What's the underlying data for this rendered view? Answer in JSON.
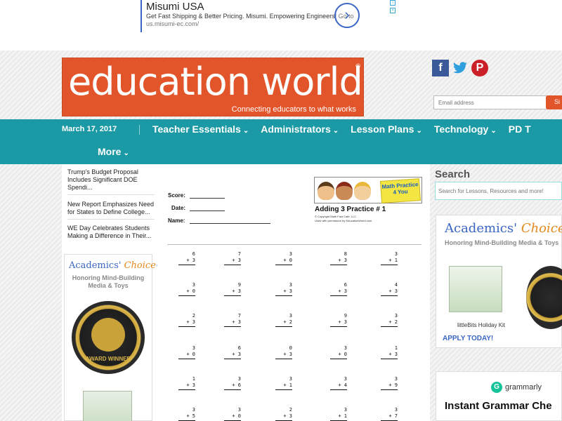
{
  "ad": {
    "title": "Misumi USA",
    "text": "Get Fast Shipping & Better Pricing. Misumi. Empowering Engineers!",
    "link": "Go to us.misumi-ec.com/"
  },
  "logo": {
    "word1": "education",
    "word2": "world",
    "reg": "®",
    "tagline": "Connecting educators to what works"
  },
  "email": {
    "placeholder": "Email address",
    "button": "Si"
  },
  "nav": {
    "date": "March 17, 2017",
    "items": [
      "Teacher Essentials",
      "Administrators",
      "Lesson Plans",
      "Technology",
      "PD T"
    ],
    "more": "More"
  },
  "news": [
    "Trump's Budget Proposal Includes Significant DOE Spendi...",
    "New Report Emphasizes Need for States to Define College...",
    "WE Day Celebrates Students Making a Difference in Their..."
  ],
  "academics_left": {
    "title_a": "Academics'",
    "title_b": "Choice",
    "tm": "™",
    "subtitle": "Honoring Mind-Building Media & Toys",
    "medal_text": "AWARD WINNER"
  },
  "worksheet": {
    "score": "Score:",
    "date": "Date:",
    "name": "Name:",
    "badge": "Math Practice 4 You",
    "title": "Adding 3  Practice # 1",
    "copyright": "© Copyright Math Fact Cafe, LLC",
    "used": "Used with permission by EducationWorld.com",
    "rows": [
      [
        [
          "6",
          "3"
        ],
        [
          "7",
          "3"
        ],
        [
          "3",
          "0"
        ],
        [
          "8",
          "3"
        ],
        [
          "3",
          "1"
        ]
      ],
      [
        [
          "3",
          "0"
        ],
        [
          "9",
          "3"
        ],
        [
          "3",
          "3"
        ],
        [
          "6",
          "3"
        ],
        [
          "4",
          "3"
        ]
      ],
      [
        [
          "2",
          "3"
        ],
        [
          "7",
          "3"
        ],
        [
          "3",
          "2"
        ],
        [
          "9",
          "3"
        ],
        [
          "3",
          "2"
        ]
      ],
      [
        [
          "3",
          "0"
        ],
        [
          "6",
          "3"
        ],
        [
          "0",
          "3"
        ],
        [
          "3",
          "0"
        ],
        [
          "1",
          "3"
        ]
      ],
      [
        [
          "1",
          "3"
        ],
        [
          "3",
          "6"
        ],
        [
          "3",
          "1"
        ],
        [
          "3",
          "4"
        ],
        [
          "3",
          "9"
        ]
      ],
      [
        [
          "3",
          "5"
        ],
        [
          "3",
          "0"
        ],
        [
          "2",
          "3"
        ],
        [
          "3",
          "1"
        ],
        [
          "3",
          "7"
        ]
      ]
    ]
  },
  "search": {
    "title": "Search",
    "placeholder": "Search for Lessons, Resources and more!"
  },
  "academics_right": {
    "title_a": "Academics'",
    "title_b": "Choice",
    "subtitle": "Honoring Mind-Building Media & Toys",
    "kit_label": "littleBits Holiday Kit",
    "apply": "APPLY TODAY!"
  },
  "grammarly": {
    "brand": "grammarly",
    "headline": "Instant Grammar Che"
  },
  "colors": {
    "brand_orange": "#e2542a",
    "nav_teal": "#1b9aa6",
    "ac_blue": "#3a66c4"
  }
}
